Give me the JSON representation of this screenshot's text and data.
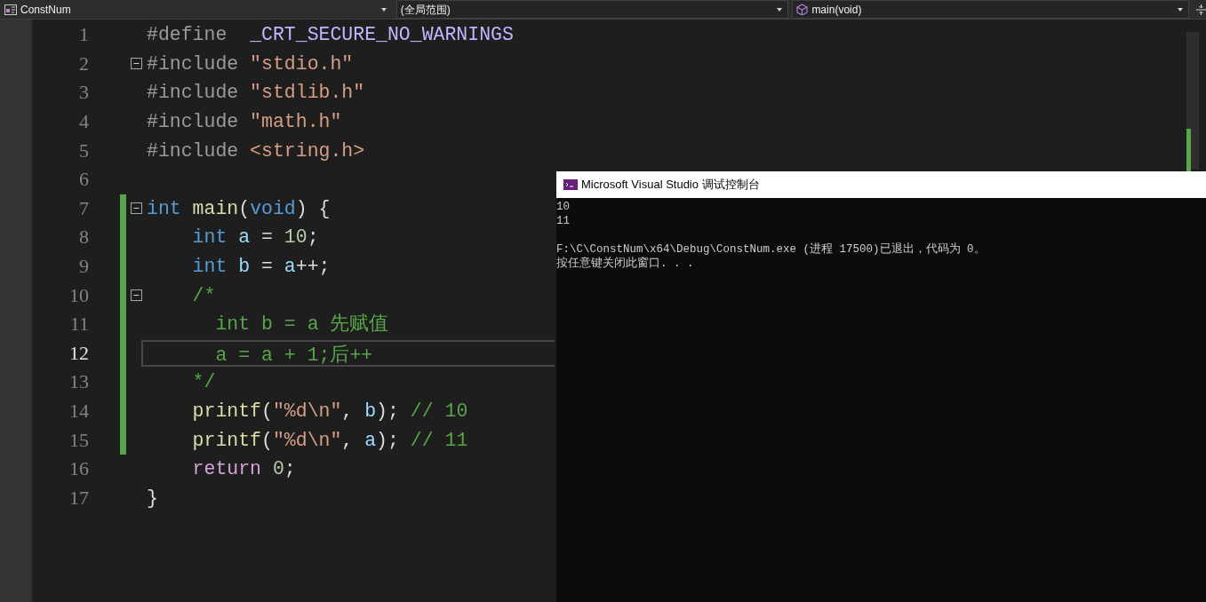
{
  "navbar": {
    "dropdowns": [
      {
        "label": "ConstNum"
      },
      {
        "label": "(全局范围)"
      },
      {
        "label": "main(void)"
      }
    ]
  },
  "editor": {
    "lines": [
      {
        "number": "1",
        "current": false,
        "changed": false,
        "fold": false,
        "tokens": [
          {
            "kind": "preproc",
            "text": "#define"
          },
          {
            "kind": "macro",
            "text": "  _CRT_SECURE_NO_WARNINGS"
          }
        ]
      },
      {
        "number": "2",
        "current": false,
        "changed": false,
        "fold": true,
        "tokens": [
          {
            "kind": "preproc",
            "text": "#include"
          },
          {
            "kind": "string",
            "text": " \"stdio.h\""
          }
        ]
      },
      {
        "number": "3",
        "current": false,
        "changed": false,
        "fold": false,
        "tokens": [
          {
            "kind": "preproc",
            "text": "#include"
          },
          {
            "kind": "string",
            "text": " \"stdlib.h\""
          }
        ]
      },
      {
        "number": "4",
        "current": false,
        "changed": false,
        "fold": false,
        "tokens": [
          {
            "kind": "preproc",
            "text": "#include"
          },
          {
            "kind": "string",
            "text": " \"math.h\""
          }
        ]
      },
      {
        "number": "5",
        "current": false,
        "changed": false,
        "fold": false,
        "tokens": [
          {
            "kind": "preproc",
            "text": "#include"
          },
          {
            "kind": "string",
            "text": " <string.h>"
          }
        ]
      },
      {
        "number": "6",
        "current": false,
        "changed": false,
        "fold": false
      },
      {
        "number": "7",
        "current": false,
        "changed": true,
        "fold": true,
        "tokens": [
          {
            "kind": "keyword",
            "text": "int"
          },
          {
            "kind": "function",
            "text": " main"
          },
          {
            "kind": "plain",
            "text": "("
          },
          {
            "kind": "keyword",
            "text": "void"
          },
          {
            "kind": "plain",
            "text": ") {"
          }
        ]
      },
      {
        "number": "8",
        "current": false,
        "changed": true,
        "fold": false,
        "tokens": [
          {
            "kind": "keyword",
            "text": "    int"
          },
          {
            "kind": "variable",
            "text": " a"
          },
          {
            "kind": "plain",
            "text": " = "
          },
          {
            "kind": "number",
            "text": "10"
          },
          {
            "kind": "plain",
            "text": ";"
          }
        ]
      },
      {
        "number": "9",
        "current": false,
        "changed": true,
        "fold": false,
        "tokens": [
          {
            "kind": "keyword",
            "text": "    int"
          },
          {
            "kind": "variable",
            "text": " b"
          },
          {
            "kind": "plain",
            "text": " = "
          },
          {
            "kind": "variable",
            "text": "a"
          },
          {
            "kind": "plain",
            "text": "++;"
          }
        ]
      },
      {
        "number": "10",
        "current": false,
        "changed": true,
        "fold": true,
        "tokens": [
          {
            "kind": "comment",
            "text": "    /*"
          }
        ]
      },
      {
        "number": "11",
        "current": false,
        "changed": true,
        "fold": false,
        "tokens": [
          {
            "kind": "comment",
            "text": "      int b = a 先赋值"
          }
        ]
      },
      {
        "number": "12",
        "current": true,
        "changed": true,
        "fold": false,
        "tokens": [
          {
            "kind": "comment",
            "text": "      a = a + 1;后++"
          }
        ]
      },
      {
        "number": "13",
        "current": false,
        "changed": true,
        "fold": false,
        "tokens": [
          {
            "kind": "comment",
            "text": "    */"
          }
        ]
      },
      {
        "number": "14",
        "current": false,
        "changed": true,
        "fold": false,
        "tokens": [
          {
            "kind": "function",
            "text": "    printf"
          },
          {
            "kind": "plain",
            "text": "("
          },
          {
            "kind": "string",
            "text": "\"%d\\n\""
          },
          {
            "kind": "plain",
            "text": ", "
          },
          {
            "kind": "variable",
            "text": "b"
          },
          {
            "kind": "plain",
            "text": "); "
          },
          {
            "kind": "comment",
            "text": "// 10"
          }
        ]
      },
      {
        "number": "15",
        "current": false,
        "changed": true,
        "fold": false,
        "tokens": [
          {
            "kind": "function",
            "text": "    printf"
          },
          {
            "kind": "plain",
            "text": "("
          },
          {
            "kind": "string",
            "text": "\"%d\\n\""
          },
          {
            "kind": "plain",
            "text": ", "
          },
          {
            "kind": "variable",
            "text": "a"
          },
          {
            "kind": "plain",
            "text": "); "
          },
          {
            "kind": "comment",
            "text": "// 11"
          }
        ]
      },
      {
        "number": "16",
        "current": false,
        "changed": false,
        "fold": false,
        "tokens": [
          {
            "kind": "control",
            "text": "    return"
          },
          {
            "kind": "number",
            "text": " 0"
          },
          {
            "kind": "plain",
            "text": ";"
          }
        ]
      },
      {
        "number": "17",
        "current": false,
        "changed": false,
        "fold": false,
        "tokens": [
          {
            "kind": "plain",
            "text": "}"
          }
        ]
      }
    ]
  },
  "console": {
    "title": "Microsoft Visual Studio 调试控制台",
    "output_lines": [
      "10",
      "11"
    ],
    "exit_lines": [
      "F:\\C\\ConstNum\\x64\\Debug\\ConstNum.exe (进程 17500)已退出，代码为 0。",
      "按任意键关闭此窗口. . ."
    ]
  }
}
